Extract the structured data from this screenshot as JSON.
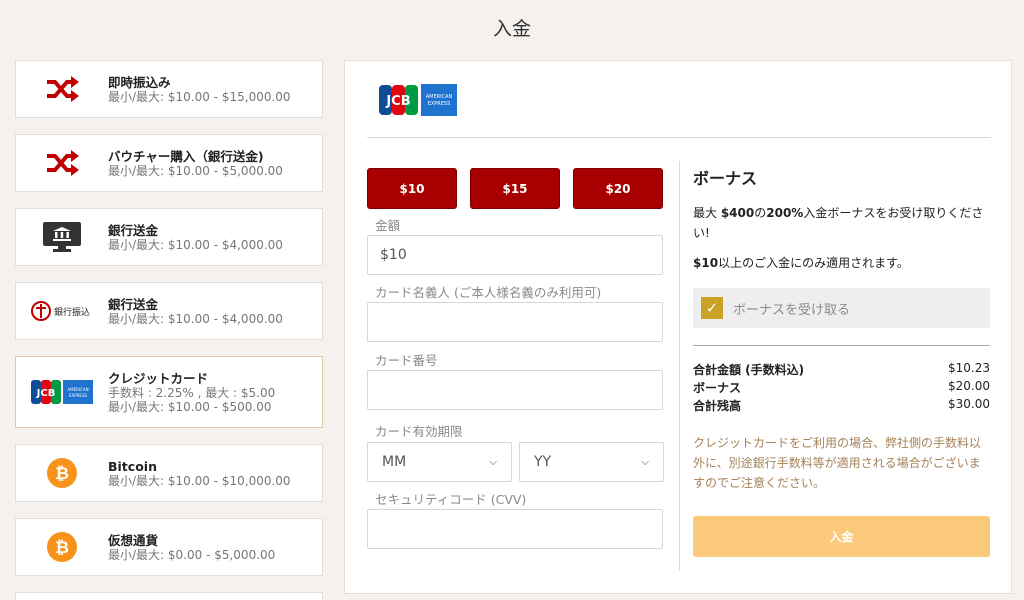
{
  "page": {
    "title": "入金"
  },
  "methods": [
    {
      "name": "即時振込み",
      "lines": [
        "最小/最大: $10.00 - $15,000.00"
      ],
      "icon": "shuffle-icon"
    },
    {
      "name": "バウチャー購入（銀行送金)",
      "lines": [
        "最小/最大: $10.00 - $5,000.00"
      ],
      "icon": "shuffle-icon"
    },
    {
      "name": "銀行送金",
      "lines": [
        "最小/最大: $10.00 - $4,000.00"
      ],
      "icon": "bank-monitor-icon"
    },
    {
      "name": "銀行送金",
      "lines": [
        "最小/最大: $10.00 - $4,000.00"
      ],
      "icon": "ginkou-furikomi-logo",
      "logo_text": "銀行振込"
    },
    {
      "name": "クレジットカード",
      "lines": [
        "手数料 : 2.25% , 最大 : $5.00",
        "最小/最大: $10.00 - $500.00"
      ],
      "icon": "jcb-amex-logo",
      "selected": true
    },
    {
      "name": "Bitcoin",
      "lines": [
        "最小/最大: $10.00 - $10,000.00"
      ],
      "icon": "bitcoin-icon"
    },
    {
      "name": "仮想通貨",
      "lines": [
        "最小/最大: $0.00 - $5,000.00"
      ],
      "icon": "bitcoin-icon"
    }
  ],
  "card_logos": {
    "jcb": "JCB",
    "amex_top": "AMERICAN",
    "amex_bottom": "EXPRESS"
  },
  "quick_amounts": [
    "$10",
    "$15",
    "$20"
  ],
  "form": {
    "amount_label": "金額",
    "amount_value": "$10",
    "holder_label": "カード名義人 (ご本人様名義のみ利用可)",
    "holder_value": "",
    "number_label": "カード番号",
    "number_value": "",
    "expiry_label": "カード有効期限",
    "month_selected": "MM",
    "year_selected": "YY",
    "cvv_label": "セキュリティコード (CVV)",
    "cvv_value": ""
  },
  "bonus": {
    "title": "ボーナス",
    "desc_prefix": "最大 ",
    "desc_max": "$400",
    "desc_mid": "の",
    "desc_pct": "200%",
    "desc_suffix": "入金ボーナスをお受け取りください!",
    "min_amount": "$10",
    "min_suffix": "以上のご入金にのみ適用されます。",
    "checkbox_label": "ボーナスを受け取る",
    "checked": true
  },
  "summary": [
    {
      "label": "合計金額 (手数料込)",
      "value": "$10.23"
    },
    {
      "label": "ボーナス",
      "value": "$20.00"
    },
    {
      "label": "合計残高",
      "value": "$30.00"
    }
  ],
  "note": "クレジットカードをご利用の場合、弊社側の手数料以外に、別途銀行手数料等が適用される場合がございますのでご注意ください。",
  "submit_label": "入金",
  "colors": {
    "background": "#f4f1ee",
    "amount_button": "#a80000",
    "checkbox": "#c9a227",
    "submit": "#fbc97a",
    "note": "#a58258",
    "shuffle_icon": "#c00000",
    "bitcoin": "#f7931a"
  }
}
